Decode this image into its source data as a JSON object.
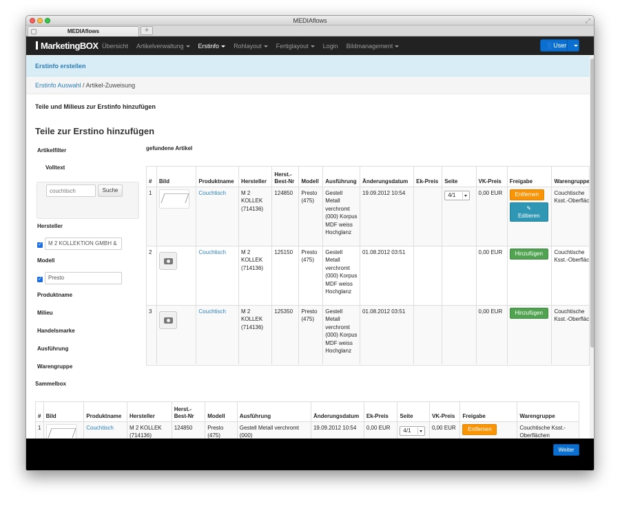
{
  "window": {
    "title": "MEDIAflows",
    "tab_title": "MEDIAflows",
    "newtab_symbol": "+"
  },
  "colors": {
    "brand": "#222222",
    "accent": "#0a6fd1",
    "warning": "#f89406",
    "success": "#51a351",
    "info": "#2f96b4"
  },
  "navbar": {
    "brand": "MarketingBOX",
    "items": [
      {
        "label": "Übersicht",
        "caret": false,
        "active": false
      },
      {
        "label": "Artikelverwaltung",
        "caret": true,
        "active": false
      },
      {
        "label": "Erstinfo",
        "caret": true,
        "active": true
      },
      {
        "label": "Rohlayout",
        "caret": true,
        "active": false
      },
      {
        "label": "Fertiglayout",
        "caret": true,
        "active": false
      },
      {
        "label": "Login",
        "caret": false,
        "active": false
      },
      {
        "label": "Bildmanagement",
        "caret": true,
        "active": false
      }
    ],
    "user_label": "User"
  },
  "alert": "Erstinfo erstellen",
  "breadcrumb": {
    "link": "Erstinfo Auswahl",
    "separator": " / ",
    "current": "Artikel-Zuweisung"
  },
  "section_title": "Teile und Milieus zur Erstinfo hinzufügen",
  "main_title": "Teile zur Erstino hinzufügen",
  "filters": {
    "heading": "Artikelfilter",
    "volltext_label": "Volltext",
    "search_placeholder": "couchtisch",
    "search_button": "Suche",
    "hersteller_label": "Hersteller",
    "hersteller_value": "M 2 KOLLEKTION GMBH &",
    "modell_label": "Modell",
    "modell_value": "Presto",
    "produktname_label": "Produktname",
    "milieu_label": "Milieu",
    "handelsmarke_label": "Handelsmarke",
    "ausfuehrung_label": "Ausführung",
    "warengruppe_label": "Warengruppe",
    "sammelbox_label": "Sammelbox"
  },
  "found_label": "gefundene Artikel",
  "table": {
    "headers": [
      "#",
      "Bild",
      "Produktname",
      "Hersteller",
      "Herst.-Best-Nr",
      "Modell",
      "Ausführung",
      "Änderungsdatum",
      "Ek-Preis",
      "Seite",
      "VK-Preis",
      "Freigabe",
      "Warengruppe"
    ],
    "rows": [
      {
        "num": "1",
        "image": "furniture",
        "produkt": "Couchtisch",
        "hersteller": "M 2 KOLLEK (714136)",
        "bestnr": "124850",
        "modell": "Presto (475)",
        "ausfuehrung": "Gestell Metall verchromt (000) Korpus MDF weiss Hochglanz",
        "datum": "19.09.2012 10:54",
        "ek": "",
        "seite": "4/1",
        "vk": "0,00 EUR",
        "freigabe": "Entfernen",
        "edit": "Editieren",
        "warengruppe": "Couchtische Ksst.-Oberflächen"
      },
      {
        "num": "2",
        "image": "camera",
        "produkt": "Couchtisch",
        "hersteller": "M 2 KOLLEK (714136)",
        "bestnr": "125150",
        "modell": "Presto (475)",
        "ausfuehrung": "Gestell Metall verchromt (000) Korpus MDF weiss Hochglanz",
        "datum": "01.08.2012 03:51",
        "ek": "",
        "seite": "",
        "vk": "0,00 EUR",
        "freigabe": "Hinzufügen",
        "warengruppe": "Couchtische Ksst.-Oberflächen"
      },
      {
        "num": "3",
        "image": "camera",
        "produkt": "Couchtisch",
        "hersteller": "M 2 KOLLEK (714136)",
        "bestnr": "125350",
        "modell": "Presto (475)",
        "ausfuehrung": "Gestell Metall verchromt (000) Korpus MDF weiss Hochglanz",
        "datum": "01.08.2012 03:51",
        "ek": "",
        "seite": "",
        "vk": "0,00 EUR",
        "freigabe": "Hinzufügen",
        "warengruppe": "Couchtische Ksst.-Oberflächen"
      }
    ]
  },
  "sammel_table": {
    "headers": [
      "#",
      "Bild",
      "Produktname",
      "Hersteller",
      "Herst.-Best-Nr",
      "Modell",
      "Ausführung",
      "Änderungsdatum",
      "Ek-Preis",
      "Seite",
      "VK-Preis",
      "Freigabe",
      "Warengruppe"
    ],
    "rows": [
      {
        "num": "1",
        "produkt": "Couchtisch",
        "hersteller": "M 2 KOLLEK (714136)",
        "bestnr": "124850",
        "modell": "Presto (475)",
        "ausfuehrung": "Gestell Metall verchromt (000)",
        "datum": "19.09.2012 10:54",
        "ek": "0,00 EUR",
        "seite": "4/1",
        "vk": "0,00 EUR",
        "freigabe": "Entfernen",
        "warengruppe": "Couchtische Ksst.-Oberflächen"
      }
    ]
  },
  "footer": {
    "weiter": "Weiter"
  }
}
